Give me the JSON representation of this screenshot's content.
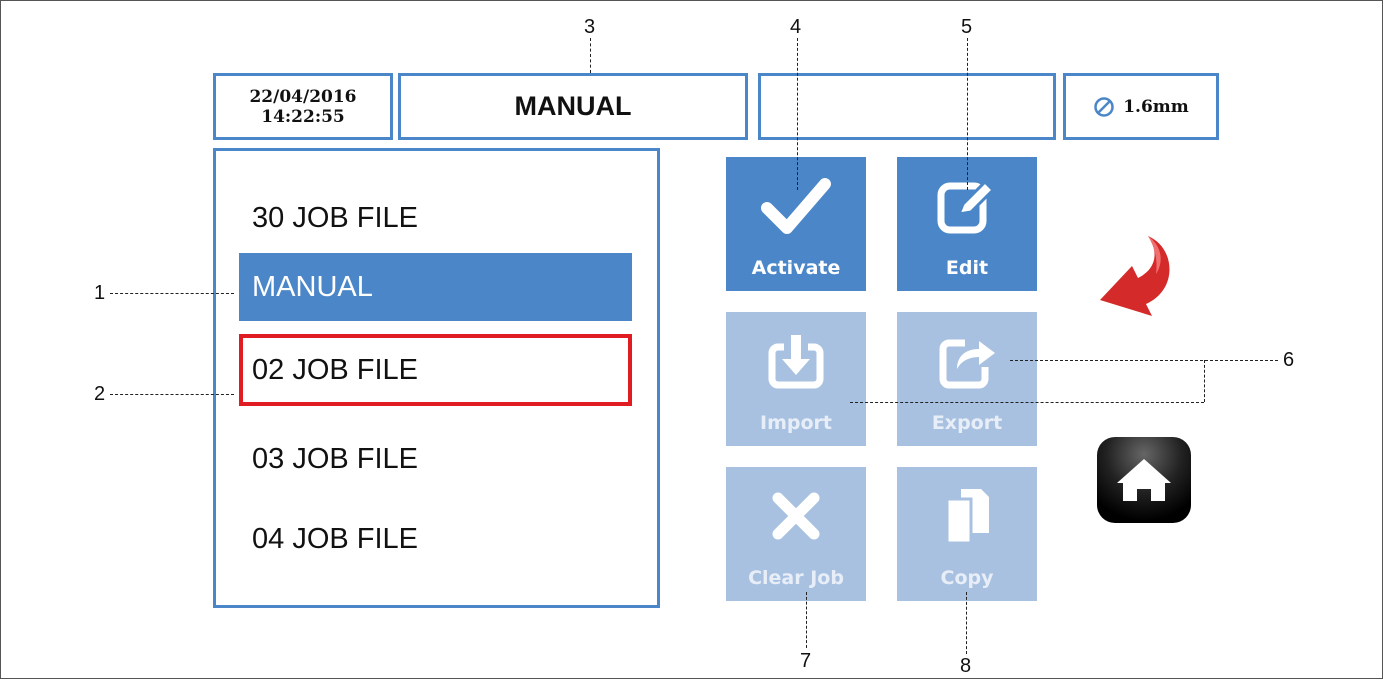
{
  "header": {
    "date": "22/04/2016",
    "time": "14:22:55",
    "mode": "MANUAL",
    "status": "",
    "wire_size": "1.6mm"
  },
  "job_list": [
    {
      "label": "30 JOB FILE",
      "state": "normal"
    },
    {
      "label": "MANUAL",
      "state": "active"
    },
    {
      "label": "02 JOB FILE",
      "state": "focused"
    },
    {
      "label": "03 JOB FILE",
      "state": "normal"
    },
    {
      "label": "04 JOB FILE",
      "state": "normal"
    }
  ],
  "buttons": {
    "activate": {
      "label": "Activate",
      "icon": "checkmark-icon",
      "enabled": true
    },
    "edit": {
      "label": "Edit",
      "icon": "edit-icon",
      "enabled": true
    },
    "import": {
      "label": "Import",
      "icon": "import-icon",
      "enabled": false
    },
    "export": {
      "label": "Export",
      "icon": "export-icon",
      "enabled": false
    },
    "clear_job": {
      "label": "Clear Job",
      "icon": "x-icon",
      "enabled": false
    },
    "copy": {
      "label": "Copy",
      "icon": "copy-icon",
      "enabled": false
    }
  },
  "nav": {
    "back_icon": "back-arrow-icon",
    "home_icon": "home-icon"
  },
  "callouts": [
    "1",
    "2",
    "3",
    "4",
    "5",
    "6",
    "7",
    "8"
  ],
  "colors": {
    "accent": "#4a86c8",
    "disabled": "#a8c1e1",
    "focus": "#e01b22",
    "back_arrow": "#d42a2a"
  }
}
